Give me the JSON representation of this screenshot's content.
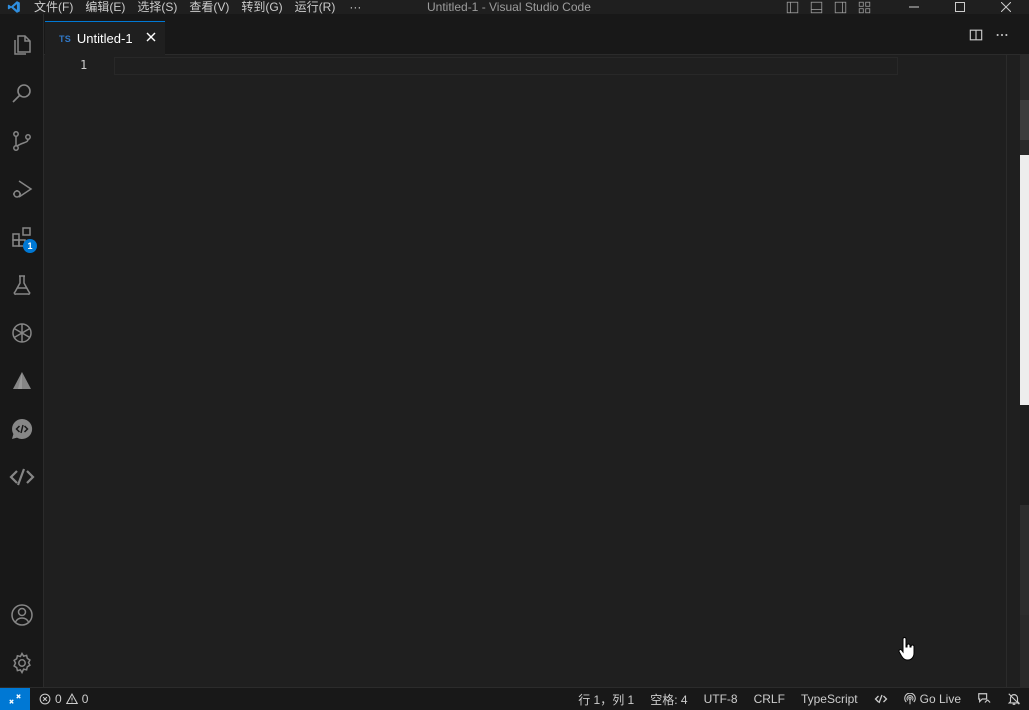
{
  "titlebar": {
    "app_logo": "vscode-logo-icon",
    "menu": [
      {
        "label": "文件(F)"
      },
      {
        "label": "编辑(E)"
      },
      {
        "label": "选择(S)"
      },
      {
        "label": "查看(V)"
      },
      {
        "label": "转到(G)"
      },
      {
        "label": "运行(R)"
      }
    ],
    "menu_more": "···",
    "window_title": "Untitled-1 - Visual Studio Code"
  },
  "activity_bar": {
    "items": [
      {
        "name": "explorer-icon"
      },
      {
        "name": "search-icon"
      },
      {
        "name": "source-control-icon"
      },
      {
        "name": "run-debug-icon"
      },
      {
        "name": "extensions-icon",
        "badge": "1"
      },
      {
        "name": "testing-icon"
      },
      {
        "name": "chatgpt-icon"
      },
      {
        "name": "tabnine-icon"
      },
      {
        "name": "code-chat-icon"
      },
      {
        "name": "codegeex-icon"
      }
    ],
    "bottom": [
      {
        "name": "accounts-icon"
      },
      {
        "name": "manage-gear-icon"
      }
    ]
  },
  "tabs": [
    {
      "badge": "TS",
      "label": "Untitled-1",
      "active": true
    }
  ],
  "editor": {
    "line_numbers": [
      "1"
    ]
  },
  "status_bar": {
    "errors": "0",
    "warnings": "0",
    "position": "行 1，列 1",
    "indent": "空格: 4",
    "encoding": "UTF-8",
    "eol": "CRLF",
    "language": "TypeScript",
    "go_live": "Go Live"
  },
  "colors": {
    "accent": "#0078d4",
    "ts_badge": "#3178c6",
    "background": "#1f1f1f",
    "sidebar": "#181818"
  }
}
